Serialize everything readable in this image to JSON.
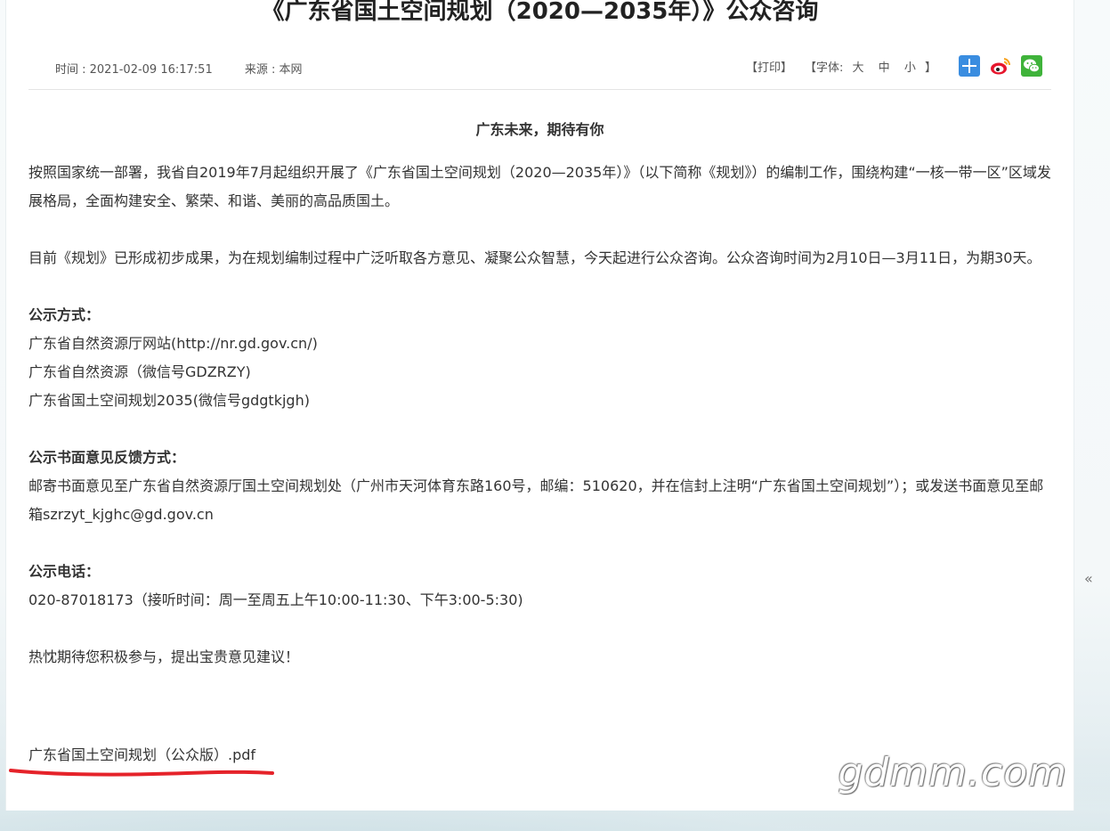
{
  "article": {
    "title": "《广东省国土空间规划（2020—2035年）》公众咨询",
    "time_label": "时间 : 2021-02-09 16:17:51",
    "source_label": "来源 : 本网"
  },
  "toolbar": {
    "print": "【打印】",
    "font_prefix": "【字体:",
    "font_large": "大",
    "font_medium": "中",
    "font_small": "小",
    "font_suffix": "】",
    "share_icons": [
      "share-plus-icon",
      "weibo-icon",
      "wechat-icon"
    ],
    "colors": {
      "plus": "#3a8de0",
      "weibo": "#e6162d",
      "wechat": "#3fb33a"
    }
  },
  "body": {
    "lead": "广东未来，期待有你",
    "p1": "按照国家统一部署，我省自2019年7月起组织开展了《广东省国土空间规划（2020—2035年）》（以下简称《规划》）的编制工作，围绕构建“一核一带一区”区域发展格局，全面构建安全、繁荣、和谐、美丽的高品质国土。",
    "p2": "目前《规划》已形成初步成果，为在规划编制过程中广泛听取各方意见、凝聚公众智慧，今天起进行公众咨询。公众咨询时间为2月10日—3月11日，为期30天。",
    "notice_heading": "公示方式：",
    "notice_items": [
      "广东省自然资源厅网站(http://nr.gd.gov.cn/)",
      "广东省自然资源（微信号GDZRZY)",
      "广东省国土空间规划2035(微信号gdgtkjgh)"
    ],
    "feedback_heading": "公示书面意见反馈方式：",
    "feedback_text": "邮寄书面意见至广东省自然资源厅国土空间规划处（广州市天河体育东路160号，邮编：510620，并在信封上注明“广东省国土空间规划”）；或发送书面意见至邮箱szrzyt_kjghc@gd.gov.cn",
    "phone_heading": "公示电话：",
    "phone_text": "020-87018173（接听时间：周一至周五上午10:00-11:30、下午3:00-5:30)",
    "closing": "热忱期待您积极参与，提出宝贵意见建议！",
    "attachment": "广东省国土空间规划（公众版）.pdf"
  },
  "watermark": "gdmm.com",
  "side_arrow": "«"
}
